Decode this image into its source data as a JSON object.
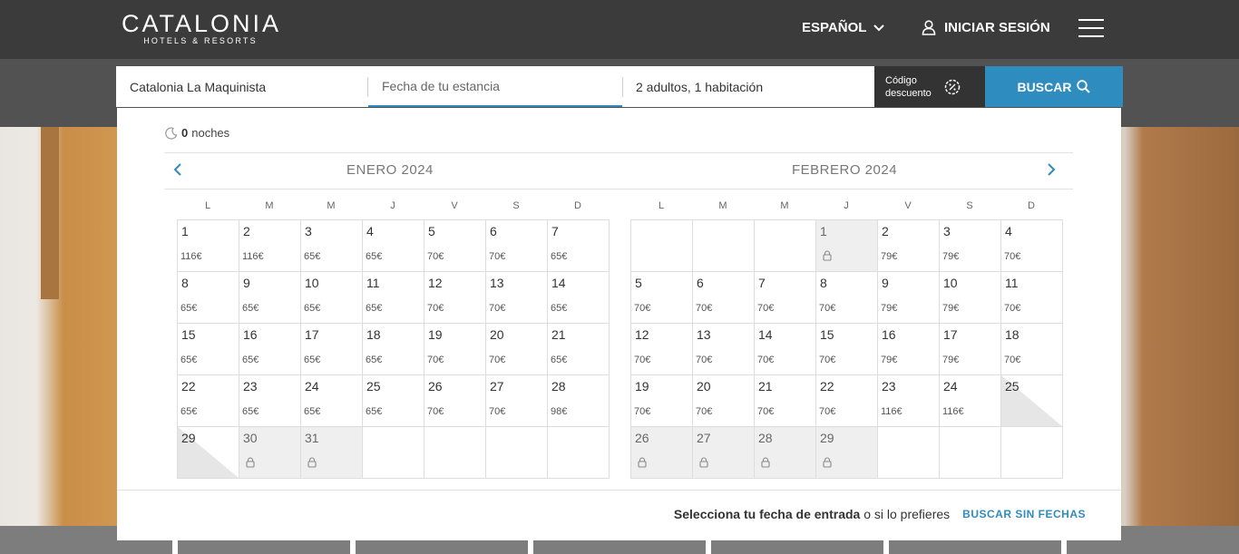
{
  "header": {
    "logo_main": "CATALONIA",
    "logo_sub": "HOTELS & RESORTS",
    "language": "ESPAÑOL",
    "login": "INICIAR SESIÓN"
  },
  "search": {
    "hotel": "Catalonia La Maquinista",
    "date_placeholder": "Fecha de tu estancia",
    "guests": "2 adultos, 1 habitación",
    "discount_line1": "Código",
    "discount_line2": "descuento",
    "button": "BUSCAR"
  },
  "calendar": {
    "nights_count": "0",
    "nights_label": "noches",
    "weekdays": [
      "L",
      "M",
      "M",
      "J",
      "V",
      "S",
      "D"
    ],
    "months": [
      {
        "title": "ENERO 2024",
        "cells": [
          {
            "day": "1",
            "price": "116€"
          },
          {
            "day": "2",
            "price": "116€"
          },
          {
            "day": "3",
            "price": "65€"
          },
          {
            "day": "4",
            "price": "65€"
          },
          {
            "day": "5",
            "price": "70€"
          },
          {
            "day": "6",
            "price": "70€"
          },
          {
            "day": "7",
            "price": "65€"
          },
          {
            "day": "8",
            "price": "65€"
          },
          {
            "day": "9",
            "price": "65€"
          },
          {
            "day": "10",
            "price": "65€"
          },
          {
            "day": "11",
            "price": "65€"
          },
          {
            "day": "12",
            "price": "70€"
          },
          {
            "day": "13",
            "price": "70€"
          },
          {
            "day": "14",
            "price": "65€"
          },
          {
            "day": "15",
            "price": "65€"
          },
          {
            "day": "16",
            "price": "65€"
          },
          {
            "day": "17",
            "price": "65€"
          },
          {
            "day": "18",
            "price": "65€"
          },
          {
            "day": "19",
            "price": "70€"
          },
          {
            "day": "20",
            "price": "70€"
          },
          {
            "day": "21",
            "price": "65€"
          },
          {
            "day": "22",
            "price": "65€"
          },
          {
            "day": "23",
            "price": "65€"
          },
          {
            "day": "24",
            "price": "65€"
          },
          {
            "day": "25",
            "price": "65€"
          },
          {
            "day": "26",
            "price": "70€"
          },
          {
            "day": "27",
            "price": "70€"
          },
          {
            "day": "28",
            "price": "98€"
          },
          {
            "day": "29",
            "state": "diag-l"
          },
          {
            "day": "30",
            "state": "locked"
          },
          {
            "day": "31",
            "state": "locked"
          },
          {
            "state": "empty"
          },
          {
            "state": "empty"
          },
          {
            "state": "empty"
          },
          {
            "state": "empty"
          }
        ]
      },
      {
        "title": "FEBRERO 2024",
        "cells": [
          {
            "state": "empty"
          },
          {
            "state": "empty"
          },
          {
            "state": "empty"
          },
          {
            "day": "1",
            "state": "locked"
          },
          {
            "day": "2",
            "price": "79€"
          },
          {
            "day": "3",
            "price": "79€"
          },
          {
            "day": "4",
            "price": "70€"
          },
          {
            "day": "5",
            "price": "70€"
          },
          {
            "day": "6",
            "price": "70€"
          },
          {
            "day": "7",
            "price": "70€"
          },
          {
            "day": "8",
            "price": "70€"
          },
          {
            "day": "9",
            "price": "79€"
          },
          {
            "day": "10",
            "price": "79€"
          },
          {
            "day": "11",
            "price": "70€"
          },
          {
            "day": "12",
            "price": "70€"
          },
          {
            "day": "13",
            "price": "70€"
          },
          {
            "day": "14",
            "price": "70€"
          },
          {
            "day": "15",
            "price": "70€"
          },
          {
            "day": "16",
            "price": "79€"
          },
          {
            "day": "17",
            "price": "79€"
          },
          {
            "day": "18",
            "price": "70€"
          },
          {
            "day": "19",
            "price": "70€"
          },
          {
            "day": "20",
            "price": "70€"
          },
          {
            "day": "21",
            "price": "70€"
          },
          {
            "day": "22",
            "price": "70€"
          },
          {
            "day": "23",
            "price": "116€"
          },
          {
            "day": "24",
            "price": "116€"
          },
          {
            "day": "25",
            "state": "diag-r"
          },
          {
            "day": "26",
            "state": "locked"
          },
          {
            "day": "27",
            "state": "locked"
          },
          {
            "day": "28",
            "state": "locked"
          },
          {
            "day": "29",
            "state": "locked"
          },
          {
            "state": "empty"
          },
          {
            "state": "empty"
          },
          {
            "state": "empty"
          }
        ]
      }
    ]
  },
  "footer": {
    "select_bold": "Selecciona tu fecha de entrada",
    "select_rest": "o si lo prefieres",
    "no_dates_link": "BUSCAR SIN FECHAS"
  },
  "icons": {
    "language": "chevron-down-icon",
    "login": "user-icon",
    "menu": "hamburger-menu-icon",
    "discount": "discount-badge-icon",
    "search": "search-icon",
    "nights": "moon-icon",
    "prev": "chevron-left-icon",
    "next": "chevron-right-icon",
    "locked": "lock-icon"
  },
  "colors": {
    "accent": "#2e8cbf",
    "header_bg": "#3b3b3b"
  }
}
